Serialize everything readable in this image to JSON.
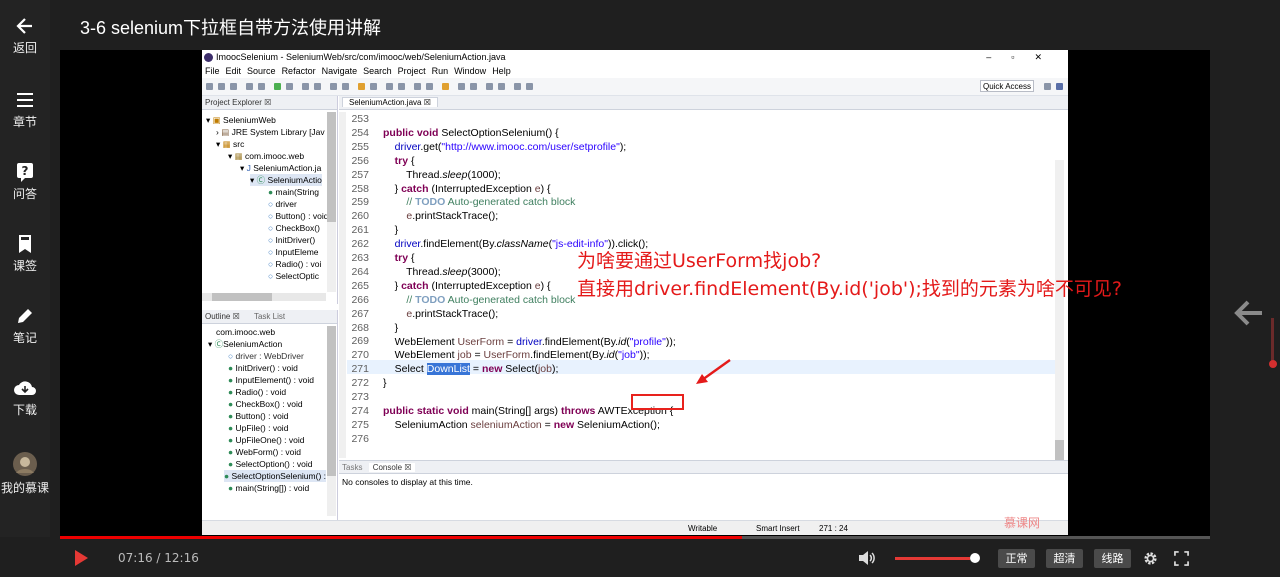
{
  "page": {
    "title": "3-6 selenium下拉框自带方法使用讲解"
  },
  "sidebar": {
    "items": [
      {
        "label": "返回",
        "icon": "back-arrow-icon"
      },
      {
        "label": "章节",
        "icon": "list-icon"
      },
      {
        "label": "问答",
        "icon": "question-icon"
      },
      {
        "label": "课签",
        "icon": "bookmark-icon"
      },
      {
        "label": "笔记",
        "icon": "pencil-icon"
      },
      {
        "label": "下载",
        "icon": "cloud-download-icon"
      },
      {
        "label": "我的慕课",
        "icon": "avatar"
      }
    ]
  },
  "eclipse": {
    "window_title": "ImoocSelenium - SeleniumWeb/src/com/imooc/web/SeleniumAction.java",
    "menu": [
      "File",
      "Edit",
      "Source",
      "Refactor",
      "Navigate",
      "Search",
      "Project",
      "Run",
      "Window",
      "Help"
    ],
    "quick_access": "Quick Access",
    "project_explorer_tab": "Project Explorer ☒",
    "tree": [
      "SeleniumWeb",
      "JRE System Library [Jav",
      "src",
      "com.imooc.web",
      "SeleniumAction.ja",
      "SeleniumActio",
      "main(String",
      "driver",
      "Button() : void",
      "CheckBox()",
      "InitDriver()",
      "InputEleme",
      "Radio() : voi",
      "SelectOptic"
    ],
    "outline_tab": "Outline ☒",
    "tasklist_tab": "Task List",
    "outline": [
      "com.imooc.web",
      "SeleniumAction",
      "driver : WebDriver",
      "InitDriver() : void",
      "InputElement() : void",
      "Radio() : void",
      "CheckBox() : void",
      "Button() : void",
      "UpFile() : void",
      "UpFileOne() : void",
      "WebForm() : void",
      "SelectOption() : void",
      "SelectOptionSelenium() :",
      "main(String[]) : void"
    ],
    "editor_tab": "SeleniumAction.java ☒",
    "line_numbers": [
      "253",
      "254",
      "255",
      "256",
      "257",
      "258",
      "259",
      "260",
      "261",
      "262",
      "263",
      "264",
      "265",
      "266",
      "267",
      "268",
      "269",
      "270",
      "271",
      "272",
      "273",
      "274",
      "275",
      "276"
    ],
    "console_tabs": [
      "Tasks",
      "Console ☒"
    ],
    "console_text": "No consoles to display at this time.",
    "status": {
      "writable": "Writable",
      "insert": "Smart Insert",
      "pos": "271 : 24"
    }
  },
  "annotations": {
    "line1": "为啥要通过UserForm找job?",
    "line2": "直接用driver.findElement(By.id('job');找到的元素为啥不可见?"
  },
  "watermark": "慕课网",
  "player": {
    "time": "07:16 / 12:16",
    "progress": 0.593,
    "volume": 0.94,
    "quality_buttons": [
      "正常",
      "超清",
      "线路"
    ]
  }
}
